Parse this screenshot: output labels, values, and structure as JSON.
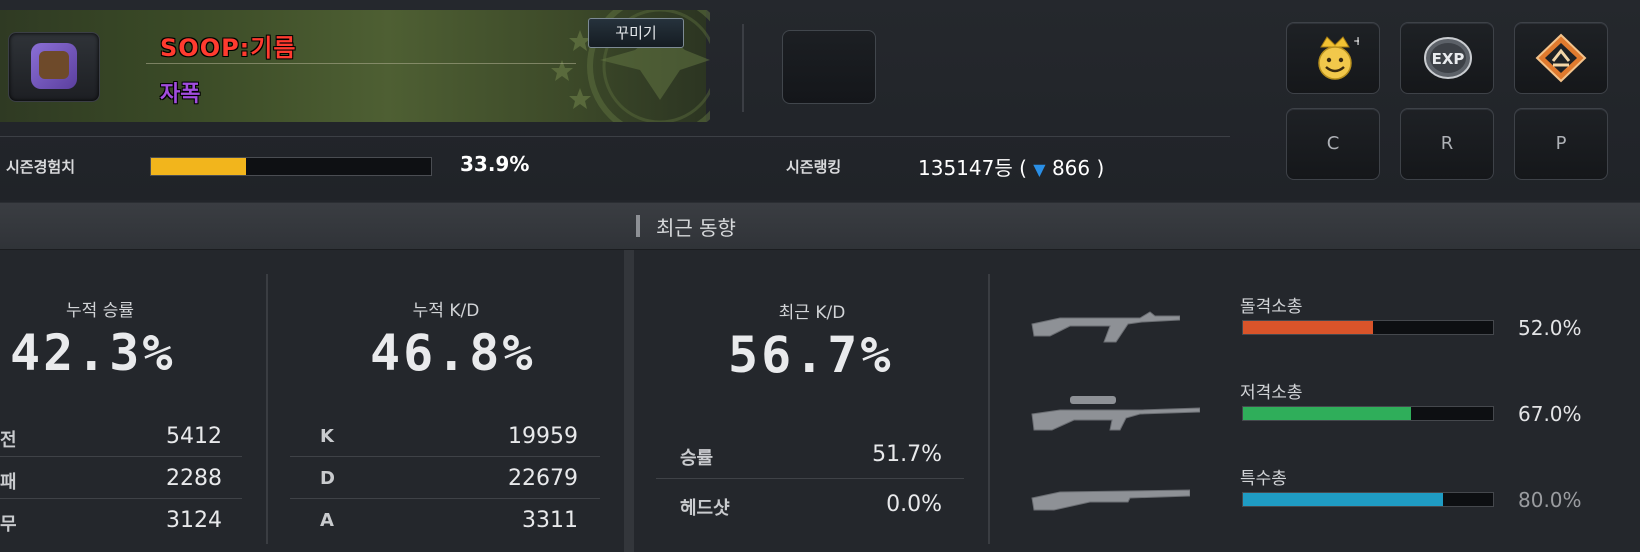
{
  "profile": {
    "nickname": "SOOP:기름",
    "clan": "자폭",
    "decorate_label": "꾸미기"
  },
  "side_buttons": {
    "row1": [
      {
        "name": "crown-smiley-icon"
      },
      {
        "name": "exp-icon",
        "text": "EXP"
      },
      {
        "name": "rank-emblem-icon"
      }
    ],
    "row2": [
      "C",
      "R",
      "P"
    ]
  },
  "season": {
    "exp_label": "시즌경험치",
    "exp_progress": 0.339,
    "exp_value": "33.9%",
    "rank_label": "시즌랭킹",
    "rank_value": "135147등 (",
    "rank_change": "866",
    "rank_close": ")"
  },
  "section": {
    "title": "최근 동향"
  },
  "cumulative_win": {
    "title": "누적 승률",
    "value": "42.3%",
    "rows": [
      {
        "label": "전",
        "value": "5412"
      },
      {
        "label": "패",
        "value": "2288"
      },
      {
        "label": "무",
        "value": "3124"
      }
    ]
  },
  "cumulative_kd": {
    "title": "누적 K/D",
    "value": "46.8%",
    "rows": [
      {
        "label": "K",
        "value": "19959"
      },
      {
        "label": "D",
        "value": "22679"
      },
      {
        "label": "A",
        "value": "3311"
      }
    ]
  },
  "recent_kd": {
    "title": "최근 K/D",
    "value": "56.7%",
    "rows": [
      {
        "label": "승률",
        "value": "51.7%"
      },
      {
        "label": "헤드샷",
        "value": "0.0%"
      }
    ]
  },
  "weapons": [
    {
      "name": "돌격소총",
      "value": "52.0%",
      "fraction": 0.52,
      "color": "#d9542a",
      "icon": "assault-rifle-icon"
    },
    {
      "name": "저격소총",
      "value": "67.0%",
      "fraction": 0.67,
      "color": "#2fae5a",
      "icon": "sniper-rifle-icon"
    },
    {
      "name": "특수총",
      "value": "80.0%",
      "fraction": 0.8,
      "color": "#1f9cc4",
      "icon": "shotgun-icon"
    }
  ]
}
